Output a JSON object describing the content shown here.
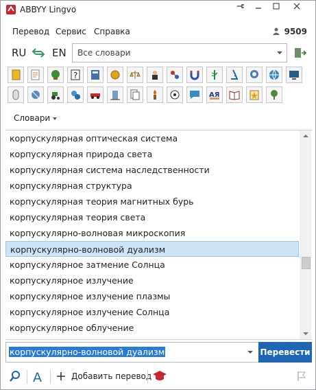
{
  "window": {
    "title": "ABBYY Lingvo",
    "controls": [
      "pin-icon",
      "minimize-icon",
      "maximize-icon",
      "close-icon"
    ]
  },
  "menu": {
    "items": [
      "Перевод",
      "Сервис",
      "Справка"
    ],
    "counter": "9509"
  },
  "lang": {
    "source": "RU",
    "target": "EN",
    "dictionary_select": "Все словари"
  },
  "toolbar": {
    "dictionaries_button": "Словари"
  },
  "results": {
    "items": [
      "корпускулярная оптическая система",
      "корпускулярная природа света",
      "корпускулярная система наследственности",
      "корпускулярная структура",
      "корпускулярная теория магнитных бурь",
      "корпускулярная теория света",
      "корпускулярно-волновая микроскопия",
      "корпускулярно-волновой дуализм",
      "корпускулярное затмение Солнца",
      "корпускулярное излучение",
      "корпускулярное излучение плазмы",
      "корпускулярное излучение Солнца",
      "корпускулярное облучение"
    ],
    "selected_index": 7,
    "scroll_position": 0.6
  },
  "input": {
    "query": "корпускулярно-волновой дуализм",
    "translate_button": "Перевести"
  },
  "bottom": {
    "add_translation": "Добавить перевод"
  },
  "colors": {
    "accent": "#1e66b3",
    "selection": "#cde4f7",
    "input_selection": "#2a7bd6"
  },
  "icons": [
    "yellow-book-icon",
    "notepad-icon",
    "globe-plant-icon",
    "question-book-icon",
    "calculator-icon",
    "coin-icon",
    "scales-icon",
    "person-icon",
    "molecule-icon",
    "magnet-icon",
    "medicine-icon",
    "microscope-icon",
    "head-icon",
    "world-icon",
    "monitor-icon",
    "mouse-icon",
    "satellite-icon",
    "tractor-icon",
    "gears-icon",
    "car-icon",
    "building-icon",
    "documents-icon",
    "torch-icon",
    "football-icon",
    "chat-icon",
    "ab-dictionary-icon",
    "open-book-icon",
    "star-book-icon",
    "tree-icon"
  ]
}
